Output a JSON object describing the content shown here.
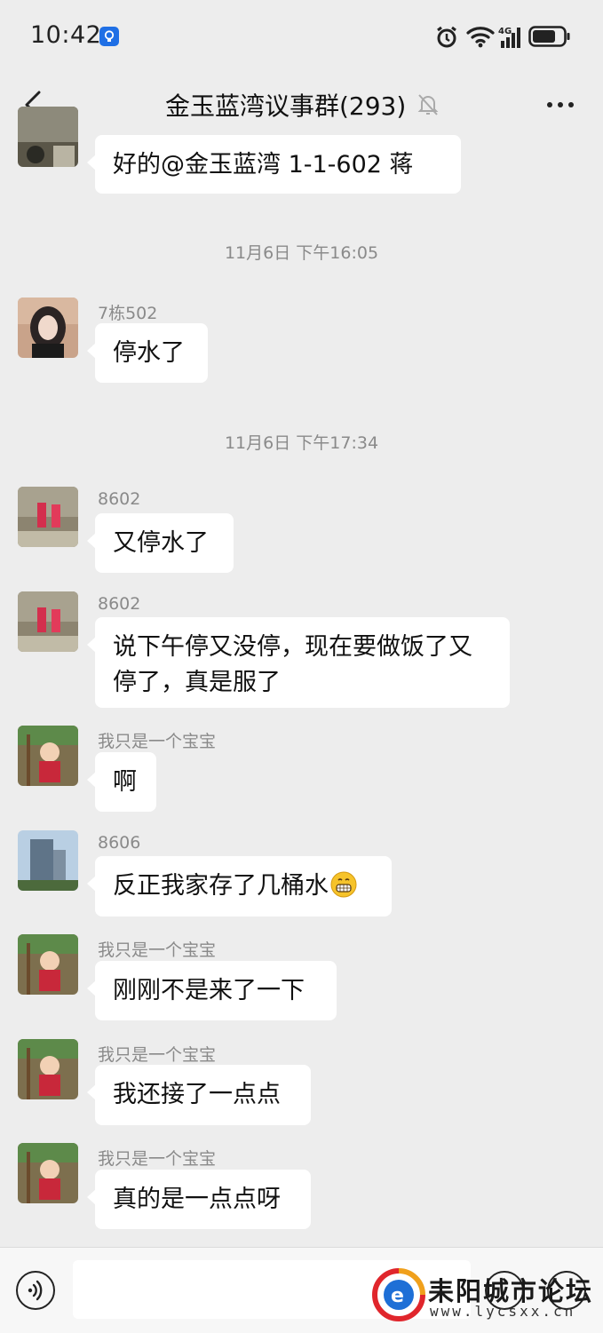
{
  "status_bar": {
    "time": "10:42",
    "network": "4G",
    "battery_level": 0.7
  },
  "header": {
    "title": "金玉蓝湾议事群(293)"
  },
  "messages": [
    {
      "sender": "",
      "text": "好的@金玉蓝湾 1-1-602  蒋"
    },
    {
      "timestamp": "11月6日 下午16:05"
    },
    {
      "sender": "7栋502",
      "text": "停水了"
    },
    {
      "timestamp": "11月6日 下午17:34"
    },
    {
      "sender": "8602",
      "text": "又停水了"
    },
    {
      "sender": "8602",
      "text_line1": "说下午停又没停，现在要做饭了又",
      "text_line2": "停了，真是服了"
    },
    {
      "sender": "我只是一个宝宝",
      "text": "啊"
    },
    {
      "sender": "8606",
      "text": "反正我家存了几桶水",
      "emoji": "grinning-face-emoji"
    },
    {
      "sender": "我只是一个宝宝",
      "text": "刚刚不是来了一下"
    },
    {
      "sender": "我只是一个宝宝",
      "text": "我还接了一点点"
    },
    {
      "sender": "我只是一个宝宝",
      "text": "真的是一点点呀"
    }
  ],
  "input": {
    "placeholder": ""
  },
  "watermark": {
    "text": "耒阳城市论坛",
    "url": "www.lycsxx.cn"
  },
  "colors": {
    "background": "#ededed",
    "bubble": "#ffffff",
    "meta_text": "#8a8a8a",
    "accent": "#1f6fe5"
  }
}
